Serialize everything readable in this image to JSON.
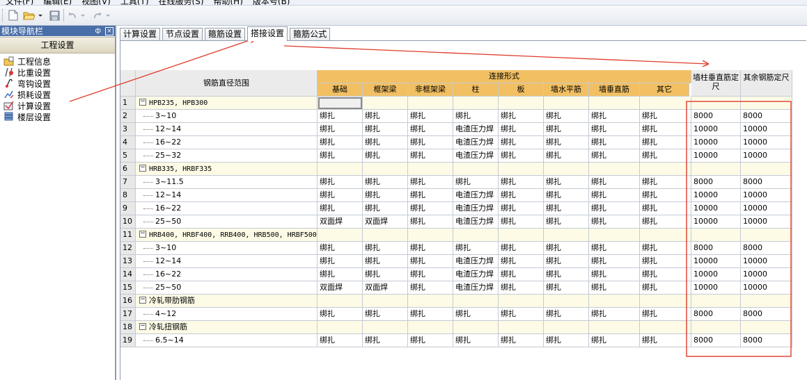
{
  "menu": [
    "文件(F)",
    "编辑(E)",
    "视图(V)",
    "工具(T)",
    "在线服务(S)",
    "帮助(H)",
    "版本号(B)"
  ],
  "toolbar": {
    "icons": [
      "new-file-icon",
      "open-folder-icon",
      "save-icon",
      "undo-icon",
      "redo-icon"
    ]
  },
  "nav": {
    "title": "模块导航栏",
    "pin": "ф",
    "close": "×",
    "group": "工程设置",
    "items": [
      {
        "label": "工程信息",
        "icon": "project-info-icon"
      },
      {
        "label": "比重设置",
        "icon": "weight-icon"
      },
      {
        "label": "弯钩设置",
        "icon": "hook-icon"
      },
      {
        "label": "损耗设置",
        "icon": "loss-icon"
      },
      {
        "label": "计算设置",
        "icon": "calc-icon"
      },
      {
        "label": "楼层设置",
        "icon": "floor-icon"
      }
    ]
  },
  "tabs": [
    "计算设置",
    "节点设置",
    "箍筋设置",
    "搭接设置",
    "箍筋公式"
  ],
  "active_tab": 3,
  "grid": {
    "range_header": "钢筋直径范围",
    "connection_header": "连接形式",
    "connection_cols": [
      "基础",
      "框架梁",
      "非框架梁",
      "柱",
      "板",
      "墙水平筋",
      "墙垂直筋",
      "其它"
    ],
    "extra_cols": [
      "墙柱垂直筋定尺",
      "其余钢筋定尺"
    ],
    "rows": [
      {
        "n": "1",
        "label": "HPB235, HPB300",
        "group": true,
        "mono": true
      },
      {
        "n": "2",
        "label": "3~10",
        "values": [
          "绑扎",
          "绑扎",
          "绑扎",
          "绑扎",
          "绑扎",
          "绑扎",
          "绑扎",
          "绑扎",
          "8000",
          "8000"
        ]
      },
      {
        "n": "3",
        "label": "12~14",
        "values": [
          "绑扎",
          "绑扎",
          "绑扎",
          "电渣压力焊",
          "绑扎",
          "绑扎",
          "绑扎",
          "绑扎",
          "10000",
          "10000"
        ]
      },
      {
        "n": "4",
        "label": "16~22",
        "values": [
          "绑扎",
          "绑扎",
          "绑扎",
          "电渣压力焊",
          "绑扎",
          "绑扎",
          "绑扎",
          "绑扎",
          "10000",
          "10000"
        ]
      },
      {
        "n": "5",
        "label": "25~32",
        "values": [
          "绑扎",
          "绑扎",
          "绑扎",
          "电渣压力焊",
          "绑扎",
          "绑扎",
          "绑扎",
          "绑扎",
          "10000",
          "10000"
        ]
      },
      {
        "n": "6",
        "label": "HRB335, HRBF335",
        "group": true,
        "mono": true
      },
      {
        "n": "7",
        "label": "3~11.5",
        "values": [
          "绑扎",
          "绑扎",
          "绑扎",
          "绑扎",
          "绑扎",
          "绑扎",
          "绑扎",
          "绑扎",
          "8000",
          "8000"
        ]
      },
      {
        "n": "8",
        "label": "12~14",
        "values": [
          "绑扎",
          "绑扎",
          "绑扎",
          "电渣压力焊",
          "绑扎",
          "绑扎",
          "绑扎",
          "绑扎",
          "10000",
          "10000"
        ]
      },
      {
        "n": "9",
        "label": "16~22",
        "values": [
          "绑扎",
          "绑扎",
          "绑扎",
          "电渣压力焊",
          "绑扎",
          "绑扎",
          "绑扎",
          "绑扎",
          "10000",
          "10000"
        ]
      },
      {
        "n": "10",
        "label": "25~50",
        "values": [
          "双面焊",
          "双面焊",
          "绑扎",
          "电渣压力焊",
          "绑扎",
          "绑扎",
          "绑扎",
          "绑扎",
          "10000",
          "10000"
        ]
      },
      {
        "n": "11",
        "label": "HRB400, HRBF400, RRB400, HRB500, HRBF500",
        "group": true,
        "mono": true
      },
      {
        "n": "12",
        "label": "3~10",
        "values": [
          "绑扎",
          "绑扎",
          "绑扎",
          "绑扎",
          "绑扎",
          "绑扎",
          "绑扎",
          "绑扎",
          "8000",
          "8000"
        ]
      },
      {
        "n": "13",
        "label": "12~14",
        "values": [
          "绑扎",
          "绑扎",
          "绑扎",
          "电渣压力焊",
          "绑扎",
          "绑扎",
          "绑扎",
          "绑扎",
          "10000",
          "10000"
        ]
      },
      {
        "n": "14",
        "label": "16~22",
        "values": [
          "绑扎",
          "绑扎",
          "绑扎",
          "电渣压力焊",
          "绑扎",
          "绑扎",
          "绑扎",
          "绑扎",
          "10000",
          "10000"
        ]
      },
      {
        "n": "15",
        "label": "25~50",
        "values": [
          "双面焊",
          "双面焊",
          "绑扎",
          "电渣压力焊",
          "绑扎",
          "绑扎",
          "绑扎",
          "绑扎",
          "10000",
          "10000"
        ]
      },
      {
        "n": "16",
        "label": "冷轧带肋钢筋",
        "group": true
      },
      {
        "n": "17",
        "label": "4~12",
        "values": [
          "绑扎",
          "绑扎",
          "绑扎",
          "绑扎",
          "绑扎",
          "绑扎",
          "绑扎",
          "绑扎",
          "8000",
          "8000"
        ]
      },
      {
        "n": "18",
        "label": "冷轧扭钢筋",
        "group": true
      },
      {
        "n": "19",
        "label": "6.5~14",
        "values": [
          "绑扎",
          "绑扎",
          "绑扎",
          "绑扎",
          "绑扎",
          "绑扎",
          "绑扎",
          "绑扎",
          "8000",
          "8000"
        ]
      }
    ]
  },
  "colors": {
    "annotation": "#e03a2a",
    "header_orange": "#f2c062",
    "group_row": "#fdfbe6",
    "nav_title": "#4a6fa8"
  }
}
